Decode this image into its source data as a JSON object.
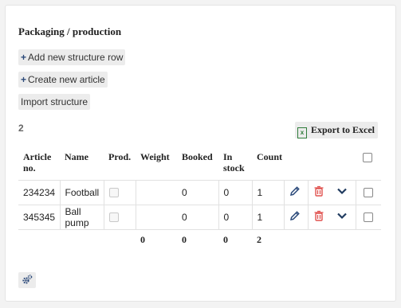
{
  "panel": {
    "title": "Packaging / production",
    "buttons": {
      "add_row": "Add new structure row",
      "create_article": "Create new article",
      "import": "Import structure"
    },
    "row_count": "2",
    "export_label": "Export to Excel"
  },
  "table": {
    "headers": {
      "article_no": "Article no.",
      "name": "Name",
      "prod": "Prod.",
      "weight": "Weight",
      "booked": "Booked",
      "in_stock": "In stock",
      "count": "Count"
    },
    "rows": [
      {
        "article_no": "234234",
        "name": "Football",
        "prod": false,
        "weight": "",
        "booked": "0",
        "in_stock": "0",
        "count": "1"
      },
      {
        "article_no": "345345",
        "name": "Ball pump",
        "prod": false,
        "weight": "",
        "booked": "0",
        "in_stock": "0",
        "count": "1"
      }
    ],
    "totals": {
      "weight": "0",
      "booked": "0",
      "in_stock": "0",
      "count": "2"
    }
  },
  "icons": {
    "edit": "pencil-icon",
    "delete": "trash-icon",
    "expand": "chevron-down-icon",
    "settings": "gear-icon",
    "excel": "excel-icon"
  },
  "colors": {
    "accent": "#2c4a7a",
    "delete": "#e0524f",
    "excel": "#2f7d3a"
  }
}
